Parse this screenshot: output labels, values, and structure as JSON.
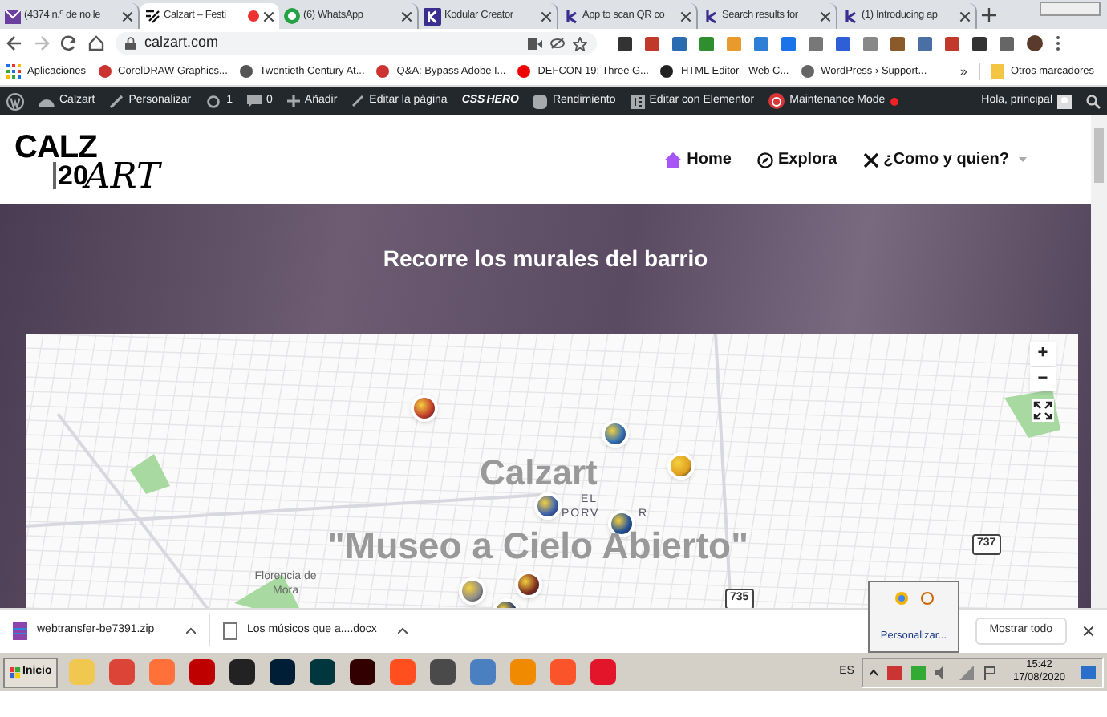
{
  "browser": {
    "tabs": [
      {
        "title": "(4374 n.º de no le",
        "selected": false,
        "recording": false
      },
      {
        "title": "Calzart – Festi",
        "selected": true,
        "recording": true
      },
      {
        "title": "(6) WhatsApp",
        "selected": false,
        "recording": false
      },
      {
        "title": "Kodular Creator",
        "selected": false,
        "recording": false
      },
      {
        "title": "App to scan QR co",
        "selected": false,
        "recording": false
      },
      {
        "title": "Search results for",
        "selected": false,
        "recording": false
      },
      {
        "title": "(1) Introducing ap",
        "selected": false,
        "recording": false
      }
    ],
    "address": "calzart.com",
    "bookmarks": [
      "Aplicaciones",
      "CorelDRAW Graphics...",
      "Twentieth Century At...",
      "Q&A: Bypass Adobe I...",
      "DEFCON 19: Three G...",
      "HTML Editor - Web C...",
      "WordPress › Support..."
    ],
    "more_bookmarks": "»",
    "other_bookmarks": "Otros marcadores"
  },
  "admin_bar": {
    "site": "Calzart",
    "customize": "Personalizar",
    "updates": "1",
    "comments": "0",
    "add": "Añadir",
    "edit_page": "Editar la página",
    "css_hero": [
      "CSS",
      "HERO"
    ],
    "performance": "Rendimiento",
    "elementor": "Editar con Elementor",
    "maintenance": "Maintenance Mode",
    "greeting": "Hola, principal"
  },
  "site": {
    "logo": [
      "CALZ",
      "20",
      "ART"
    ],
    "nav": [
      {
        "label": "Home",
        "selected": true,
        "kind": "home"
      },
      {
        "label": "Explora",
        "selected": false,
        "kind": "compass"
      },
      {
        "label": "¿Como y quien?",
        "selected": false,
        "kind": "tools"
      }
    ],
    "hero_title": "Recorre los murales del barrio",
    "map": {
      "title": "Calzart",
      "subtitle": "\"Museo a Cielo Abierto\"",
      "district": [
        "EL",
        "PORV",
        "R"
      ],
      "town": "Florencia de Mora",
      "roads": [
        "737",
        "735"
      ],
      "zoom_in": "+",
      "zoom_out": "−"
    }
  },
  "downloads": {
    "files": [
      "webtransfer-be7391.zip",
      "Los músicos que a....docx"
    ],
    "show_all": "Mostrar todo"
  },
  "tray_popup": {
    "link": "Personalizar..."
  },
  "taskbar": {
    "start": "Inicio",
    "language": "ES",
    "time": "15:42",
    "date": "17/08/2020"
  }
}
